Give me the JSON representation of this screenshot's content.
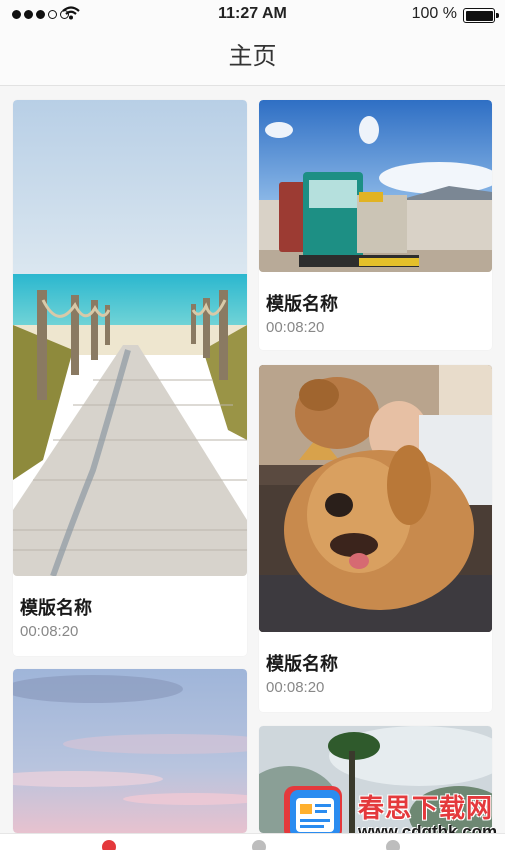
{
  "status_bar": {
    "time": "11:27 AM",
    "battery": "100 %"
  },
  "nav": {
    "title": "主页"
  },
  "cards": [
    {
      "title": "模版名称",
      "duration": "00:08:20",
      "image": "beach-boardwalk"
    },
    {
      "title": "模版名称",
      "duration": "00:08:20",
      "image": "tourist-train"
    },
    {
      "title": "模版名称",
      "duration": "00:08:20",
      "image": "woman-and-dog"
    },
    {
      "image": "pink-sky"
    },
    {
      "image": "misty-trees"
    }
  ],
  "watermark": {
    "name": "春思下载网",
    "url": "www.cdgthk.com"
  },
  "colors": {
    "accent": "#e4393c",
    "text": "#1a1a1a",
    "muted": "#888888",
    "background": "#f6f6f6"
  }
}
